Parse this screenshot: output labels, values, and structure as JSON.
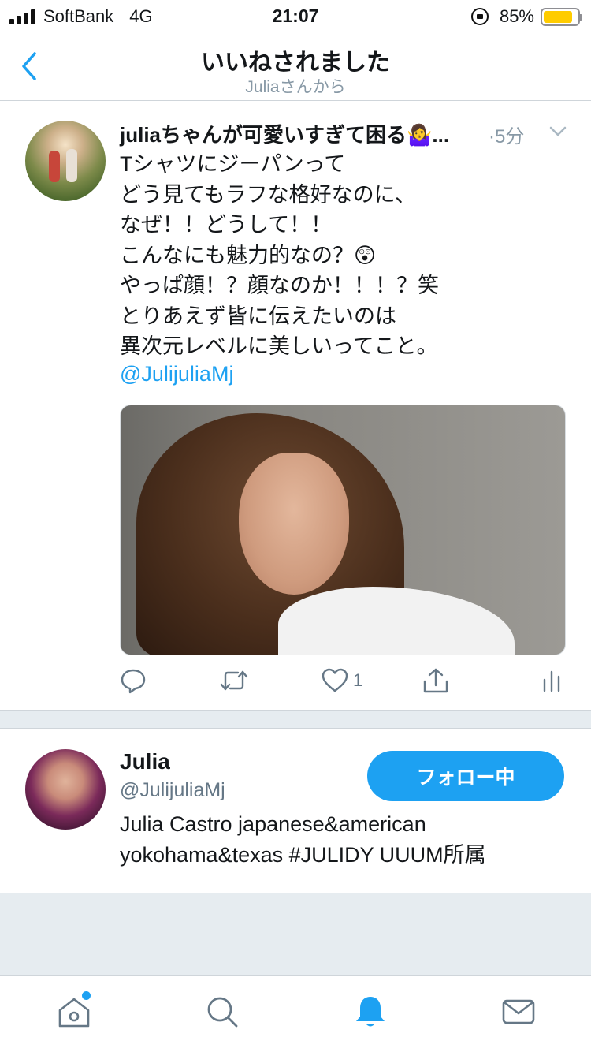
{
  "status_bar": {
    "carrier": "SoftBank",
    "network": "4G",
    "time": "21:07",
    "battery": "85%",
    "battery_level": 0.85,
    "battery_color": "#ffcc00"
  },
  "header": {
    "title": "いいねされました",
    "subtitle": "Juliaさんから"
  },
  "tweet": {
    "author": "juliaちゃんが可愛いすぎて困る🤷‍♀️...",
    "time": "·5分",
    "lines": [
      "Tシャツにジーパンって",
      "どう見てもラフな格好なのに、",
      "なぜ！！どうして！！",
      "こんなにも魅力的なの？😲",
      "やっぱ顔！？顔なのか！！！？笑",
      "とりあえず皆に伝えたいのは",
      "異次元レベルに美しいってこと。"
    ],
    "mention": "@JulijuliaMj",
    "like_count": "1"
  },
  "user_card": {
    "name": "Julia",
    "handle": "@JulijuliaMj",
    "bio_lines": [
      "Julia Castro japanese&american",
      "yokohama&texas #JULIDY UUUM所属"
    ],
    "follow_label": "フォロー中"
  },
  "colors": {
    "accent": "#1da1f2",
    "icon_gray": "#657786",
    "divider_bg": "#e6ecf0"
  },
  "tabs": [
    {
      "icon": "home-icon",
      "active": false,
      "badge": true
    },
    {
      "icon": "search-icon",
      "active": false
    },
    {
      "icon": "bell-icon",
      "active": true
    },
    {
      "icon": "mail-icon",
      "active": false
    }
  ]
}
